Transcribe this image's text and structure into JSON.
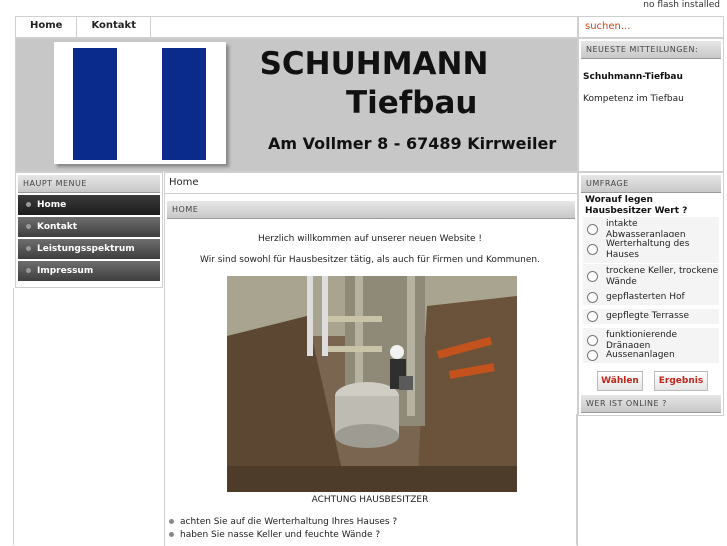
{
  "flash_notice": "no flash installed",
  "topnav": {
    "items": [
      "Home",
      "Kontakt"
    ]
  },
  "search": {
    "placeholder": "suchen..."
  },
  "header": {
    "company": "SCHUHMANN",
    "subtitle": "Tiefbau",
    "address": "Am Vollmer 8 - 67489 Kirrweiler",
    "logo_color": "#0a2a8c"
  },
  "news": {
    "heading": "NEUESTE MITTEILUNGEN:",
    "title": "Schuhmann-Tiefbau",
    "text": "Kompetenz im Tiefbau"
  },
  "menu": {
    "heading": "HAUPT MENUE",
    "items": [
      "Home",
      "Kontakt",
      "Leistungsspektrum",
      "Impressum"
    ],
    "active": "Home"
  },
  "main": {
    "breadcrumb": "Home",
    "section_heading": "HOME",
    "welcome": "Herzlich willkommen auf unserer neuen Website !",
    "intro": "Wir sind sowohl  für Hausbesitzer tätig, als auch für Firmen und Kommunen.",
    "caption": "ACHTUNG HAUSBESITZER",
    "bullets": [
      "achten Sie auf die Werterhaltung Ihres Hauses ?",
      "haben Sie nasse Keller und feuchte Wände ?"
    ]
  },
  "poll": {
    "heading": "UMFRAGE",
    "question": "Worauf legen Hausbesitzer Wert ?",
    "options": [
      "intakte Abwasseranlagen",
      "Werterhaltung des Hauses",
      "trockene Keller, trockene Wände",
      "gepflasterten Hof",
      "gepflegte Terrasse",
      "funktionierende Dränagen",
      "Aussenanlagen"
    ],
    "vote_label": "Wählen",
    "result_label": "Ergebnis"
  },
  "online": {
    "heading": "WER IST ONLINE ?"
  },
  "colors": {
    "accent": "#c0261a",
    "menu_bg": "#4a4a4a",
    "header_bg": "#c7c7c7"
  }
}
